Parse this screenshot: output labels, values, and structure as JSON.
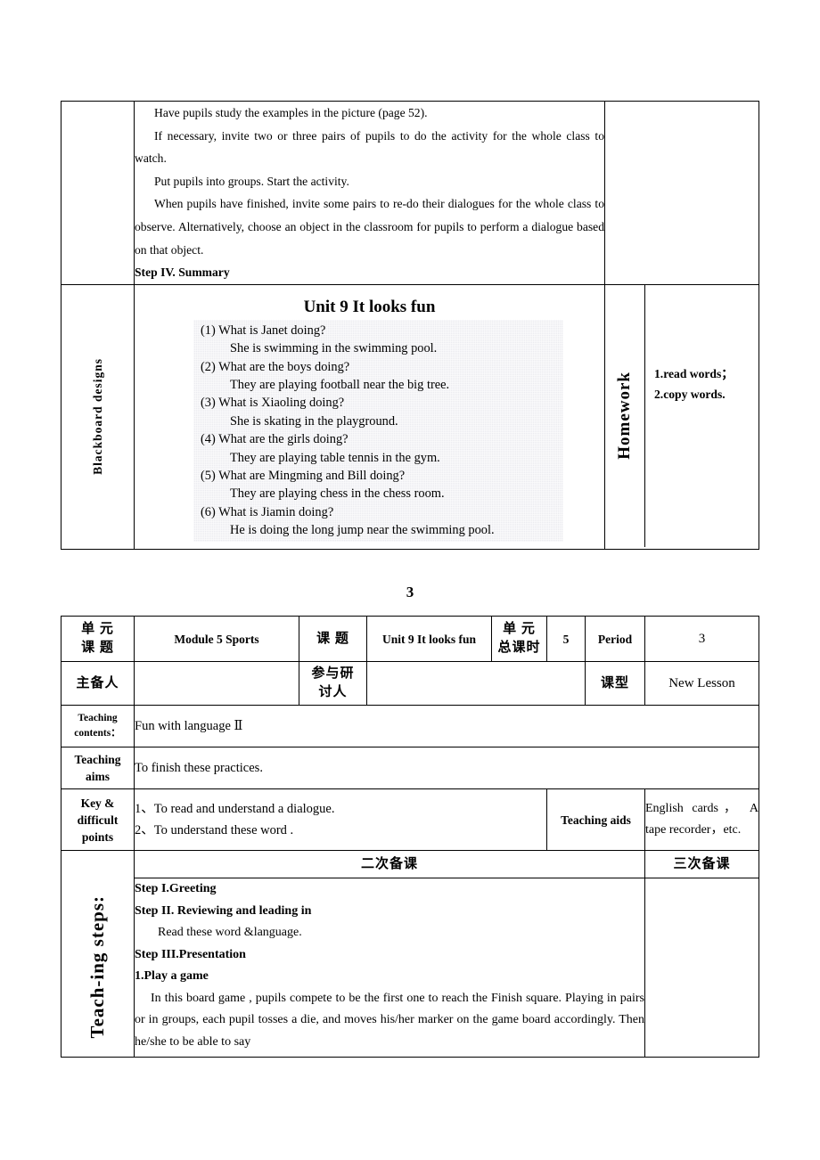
{
  "document": {
    "page_number": "3"
  },
  "table_one": {
    "steps_cell": {
      "paragraphs": [
        "Have pupils study the examples in the picture (page 52).",
        "If necessary, invite two or three pairs of pupils to do the activity for the whole class to watch.",
        "Put pupils into groups. Start the activity.",
        "When pupils have finished, invite some pairs to re-do their dialogues for the whole class to observe. Alternatively, choose an object in the classroom for pupils to perform a dialogue based on that object."
      ],
      "step_heading": "Step IV. Summary"
    },
    "blackboard": {
      "label": "Blackboard designs",
      "title": "Unit 9 It looks fun",
      "lines": [
        {
          "q": "(1) What is Janet doing?",
          "a": "She is swimming in the swimming pool."
        },
        {
          "q": "(2) What are the boys doing?",
          "a": "They are playing football near the big tree."
        },
        {
          "q": "(3) What is Xiaoling doing?",
          "a": "She is skating in the playground."
        },
        {
          "q": "(4) What are the girls doing?",
          "a": "They are playing table tennis in the gym."
        },
        {
          "q": "(5) What are Mingming and Bill doing?",
          "a": "They are playing chess in the chess room."
        },
        {
          "q": "(6) What is Jiamin doing?",
          "a": "He is doing the long jump near the swimming pool."
        }
      ]
    },
    "homework": {
      "label": "Homework",
      "items": [
        "1.read words；",
        "2.copy words."
      ]
    }
  },
  "table_two": {
    "row_unit": {
      "label_unit_topic": "单 元\n课 题",
      "value_module": "Module 5    Sports",
      "label_lesson_topic": "课 题",
      "value_lesson_topic": "Unit 9 It looks fun",
      "label_total_periods": "单 元\n总课时",
      "value_total_periods": "5",
      "label_period": "Period",
      "value_period": "3"
    },
    "row_author": {
      "label_main_author": "主备人",
      "value_main_author": "",
      "label_participants": "参与研\n讨人",
      "value_participants": "",
      "label_lesson_type": "课型",
      "value_lesson_type": "New Lesson"
    },
    "row_contents": {
      "label": "Teaching contents：",
      "value": "Fun with language    Ⅱ"
    },
    "row_aims": {
      "label": "Teaching aims",
      "value": "To finish these practices."
    },
    "row_key_points": {
      "label": "Key & difficult points",
      "values": [
        "1、To read and understand a dialogue.",
        "2、To understand these word ."
      ],
      "label_aids": "Teaching aids",
      "value_aids": "English cards， A tape recorder，etc."
    },
    "row_prep_headers": {
      "second_prep": "二次备课",
      "third_prep": "三次备课"
    },
    "row_steps": {
      "label": "Teach-ing steps:",
      "blocks": [
        {
          "type": "heading",
          "text": "Step I.Greeting"
        },
        {
          "type": "heading",
          "text": "Step II. Reviewing and leading in"
        },
        {
          "type": "sub",
          "text": "Read these word &language."
        },
        {
          "type": "heading",
          "text": "Step III.Presentation"
        },
        {
          "type": "heading",
          "text": "1.Play a game"
        },
        {
          "type": "para",
          "text": "In this board game , pupils compete to be the first one to reach the Finish square. Playing in pairs or in groups, each pupil tosses a die, and moves his/her marker on the game board accordingly. Then he/she to be able to say"
        }
      ],
      "third_prep_value": ""
    }
  }
}
